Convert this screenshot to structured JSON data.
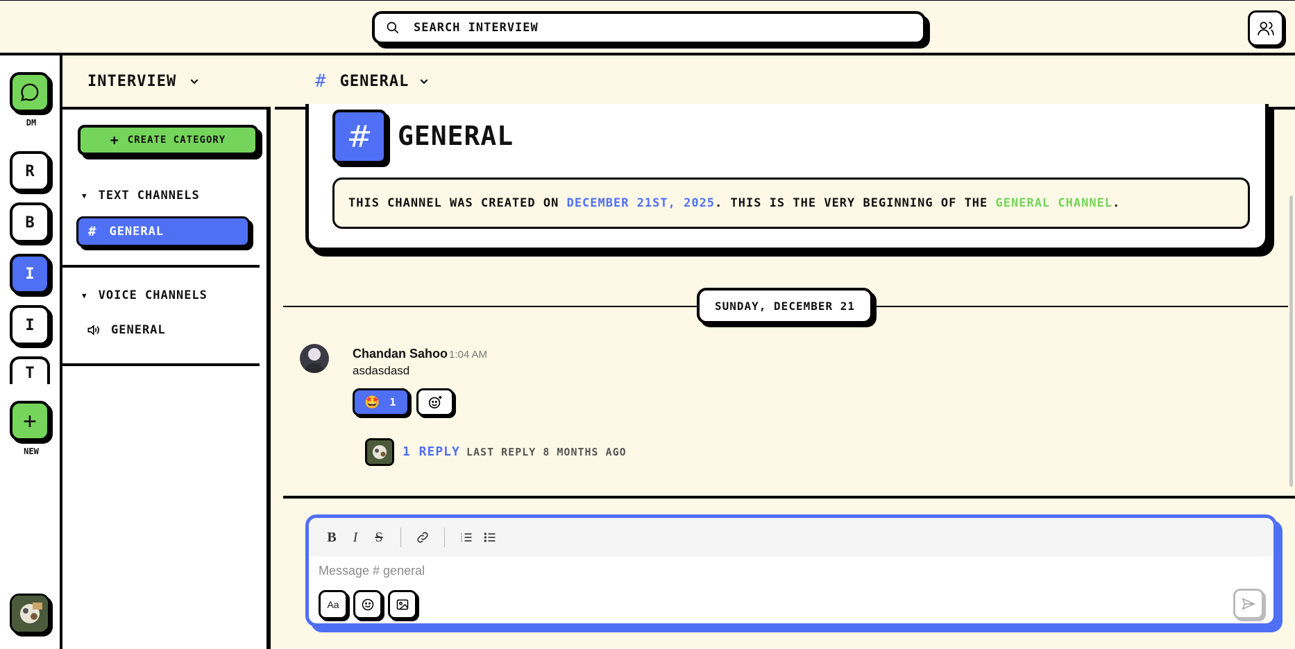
{
  "search": {
    "placeholder": "SEARCH INTERVIEW"
  },
  "rail": {
    "dm_label": "DM",
    "servers": [
      {
        "letter": "R"
      },
      {
        "letter": "B"
      },
      {
        "letter": "I",
        "active": true
      },
      {
        "letter": "I"
      },
      {
        "letter": "T"
      }
    ],
    "new_label": "NEW"
  },
  "sidebar": {
    "server_name": "INTERVIEW",
    "create_category": "CREATE CATEGORY",
    "text_category": "TEXT CHANNELS",
    "text_channel": "GENERAL",
    "voice_category": "VOICE CHANNELS",
    "voice_channel": "GENERAL"
  },
  "header": {
    "channel": "GENERAL"
  },
  "welcome": {
    "title": "GENERAL",
    "desc_prefix": "THIS CHANNEL WAS CREATED ON ",
    "date": "DECEMBER 21ST, 2025",
    "desc_middle": ". THIS IS THE VERY BEGINNING OF THE ",
    "channel_link": "GENERAL CHANNEL",
    "desc_suffix": "."
  },
  "date_divider": "SUNDAY, DECEMBER 21",
  "message": {
    "author": "Chandan Sahoo",
    "time": "1:04 AM",
    "body": "asdasdasd",
    "reaction_emoji": "🤩",
    "reaction_count": "1",
    "reply_count": "1 REPLY",
    "last_reply": "LAST REPLY 8 MONTHS AGO"
  },
  "composer": {
    "placeholder": "Message # general",
    "format_label": "Aa"
  },
  "colors": {
    "background": "#fdf9e6",
    "accent_blue": "#4f6ff5",
    "accent_green": "#75d45a",
    "border": "#000000"
  }
}
